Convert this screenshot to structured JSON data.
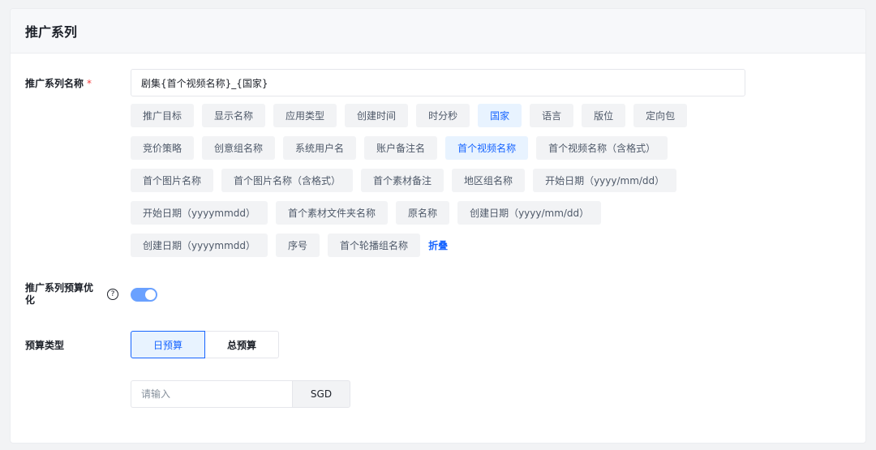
{
  "header": {
    "title": "推广系列"
  },
  "series_name": {
    "label": "推广系列名称",
    "required_mark": "*",
    "value": "剧集{首个视频名称}_{国家}"
  },
  "tag_rows": [
    [
      {
        "label": "推广目标",
        "active": false
      },
      {
        "label": "显示名称",
        "active": false
      },
      {
        "label": "应用类型",
        "active": false
      },
      {
        "label": "创建时间",
        "active": false
      },
      {
        "label": "时分秒",
        "active": false
      },
      {
        "label": "国家",
        "active": true
      },
      {
        "label": "语言",
        "active": false
      },
      {
        "label": "版位",
        "active": false
      },
      {
        "label": "定向包",
        "active": false
      }
    ],
    [
      {
        "label": "竞价策略",
        "active": false
      },
      {
        "label": "创意组名称",
        "active": false
      },
      {
        "label": "系统用户名",
        "active": false
      },
      {
        "label": "账户备注名",
        "active": false
      },
      {
        "label": "首个视频名称",
        "active": true
      },
      {
        "label": "首个视频名称（含格式）",
        "active": false
      }
    ],
    [
      {
        "label": "首个图片名称",
        "active": false
      },
      {
        "label": "首个图片名称（含格式）",
        "active": false
      },
      {
        "label": "首个素材备注",
        "active": false
      },
      {
        "label": "地区组名称",
        "active": false
      },
      {
        "label": "开始日期（yyyy/mm/dd）",
        "active": false
      }
    ],
    [
      {
        "label": "开始日期（yyyymmdd）",
        "active": false
      },
      {
        "label": "首个素材文件夹名称",
        "active": false
      },
      {
        "label": "原名称",
        "active": false
      },
      {
        "label": "创建日期（yyyy/mm/dd）",
        "active": false
      }
    ],
    [
      {
        "label": "创建日期（yyyymmdd）",
        "active": false
      },
      {
        "label": "序号",
        "active": false
      },
      {
        "label": "首个轮播组名称",
        "active": false
      }
    ]
  ],
  "fold_label": "折叠",
  "budget_opt": {
    "label_line1": "推广系列预算优",
    "label_line2": "化",
    "help_icon": "question-circle-icon",
    "enabled": true
  },
  "budget_type": {
    "label": "预算类型",
    "options": [
      "日预算",
      "总预算"
    ],
    "selected": "日预算"
  },
  "amount": {
    "placeholder": "请输入",
    "value": "",
    "currency": "SGD"
  },
  "colors": {
    "accent": "#1664ff",
    "active_bg": "#e8f3ff",
    "required": "#f53f3f",
    "switch_on": "#6aa1ff"
  }
}
